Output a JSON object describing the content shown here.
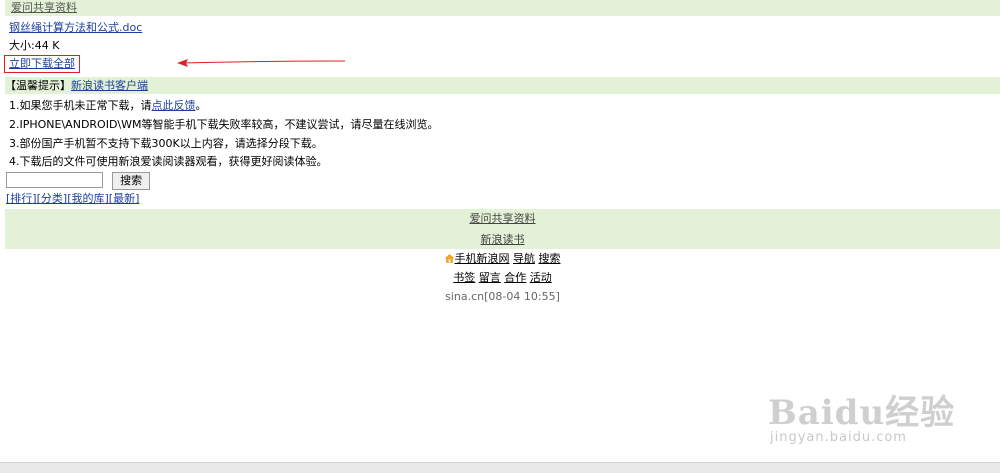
{
  "header": {
    "title": "爱问共享资料"
  },
  "file": {
    "name": "钢丝绳计算方法和公式.doc",
    "size": "大小:44 K",
    "download_label": "立即下载全部"
  },
  "tips": {
    "heading": "【温馨提示】",
    "client_link": "新浪读书客户端",
    "line1_prefix": "1.如果您手机未正常下载，请",
    "line1_link": "点此反馈",
    "line1_suffix": "。",
    "line2": "2.IPHONE\\ANDROID\\WM等智能手机下载失败率较高，不建议尝试，请尽量在线浏览。",
    "line3": "3.部份国产手机暂不支持下载300K以上内容，请选择分段下载。",
    "line4": "4.下载后的文件可使用新浪爱读阅读器观看，获得更好阅读体验。"
  },
  "search": {
    "value": "",
    "button_label": "搜索"
  },
  "nav": {
    "rank": "[排行]",
    "category": "[分类]",
    "my_library": "[我的库]",
    "latest": "[最新]"
  },
  "footer": {
    "share_link": "爱问共享资料",
    "reading_link": "新浪读书",
    "home_link": "手机新浪网",
    "nav_link": "导航",
    "search_link": "搜索",
    "bookmark": "书签",
    "message": "留言",
    "cooperation": "合作",
    "activity": "活动",
    "timestamp": "sina.cn[08-04 10:55]"
  },
  "watermark": {
    "brand": "Baidu经验",
    "url": "jingyan.baidu.com"
  },
  "colors": {
    "band": "#e3f1d6",
    "link": "#1a3f9e",
    "annotation": "#e02020"
  }
}
